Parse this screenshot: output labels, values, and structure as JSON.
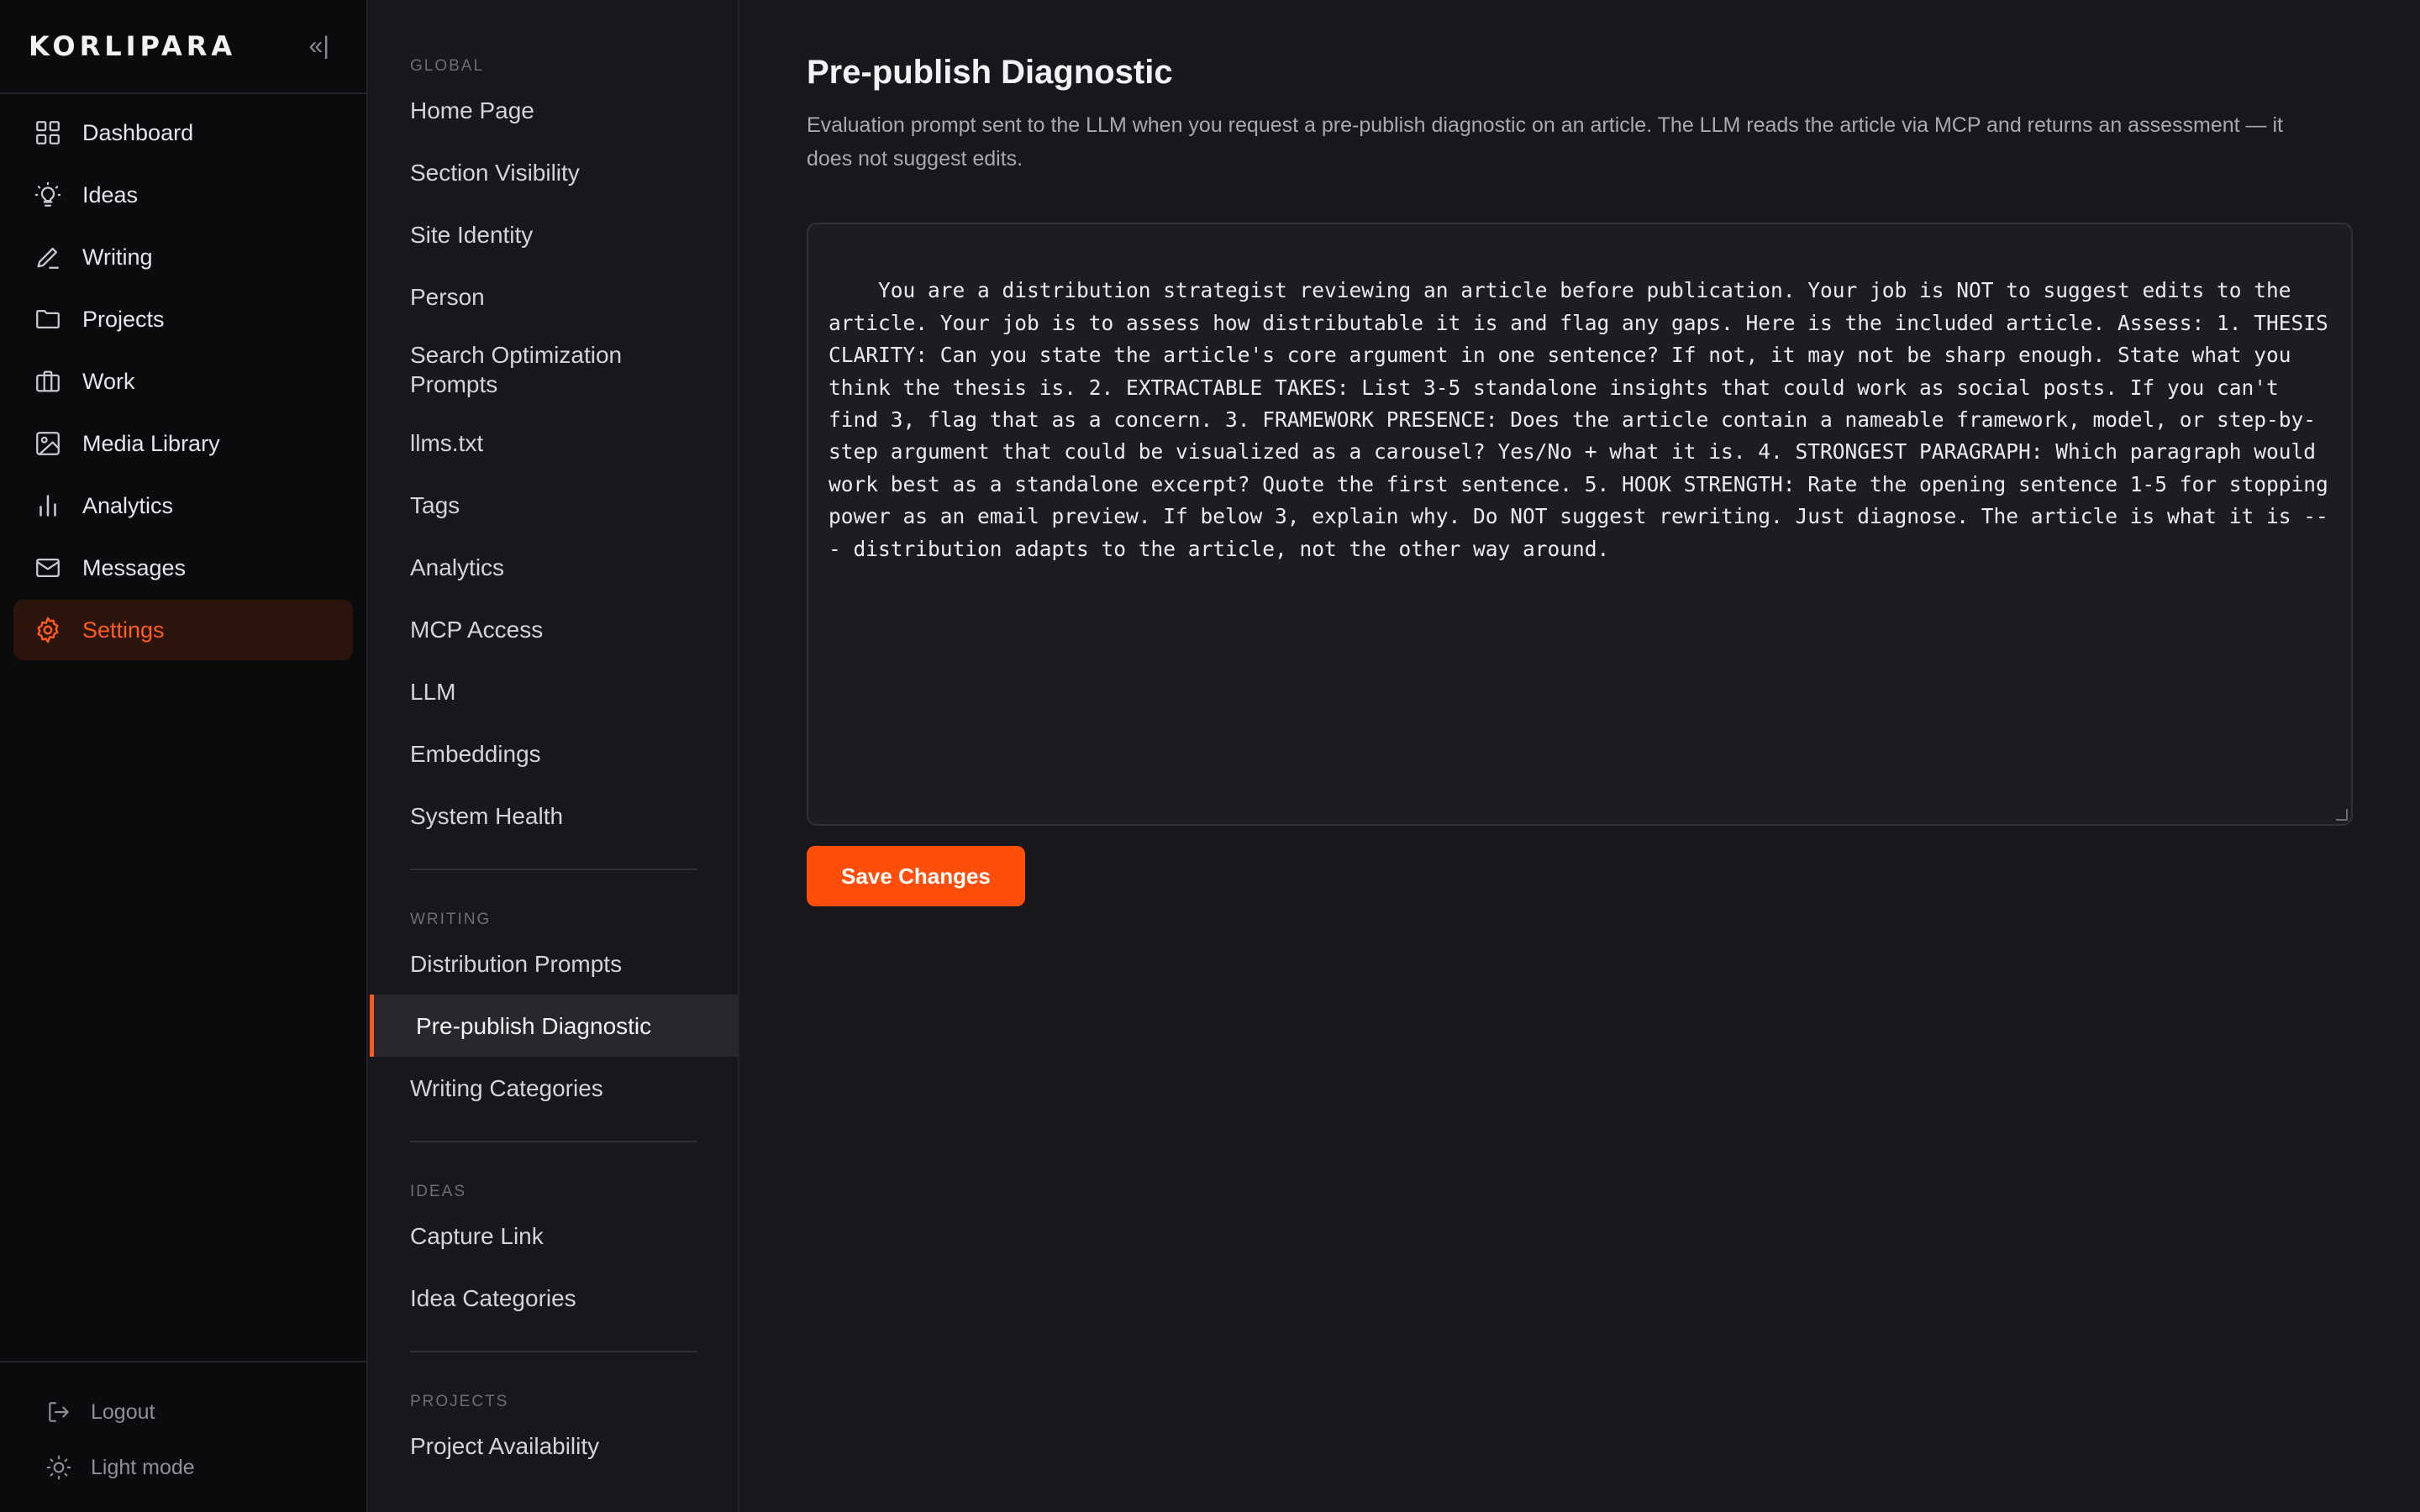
{
  "brand": {
    "name": "KORLIPARA",
    "collapse_icon": "«|"
  },
  "nav": [
    {
      "label": "Dashboard",
      "icon": "dashboard-icon"
    },
    {
      "label": "Ideas",
      "icon": "lightbulb-icon"
    },
    {
      "label": "Writing",
      "icon": "pen-icon"
    },
    {
      "label": "Projects",
      "icon": "folder-icon"
    },
    {
      "label": "Work",
      "icon": "briefcase-icon"
    },
    {
      "label": "Media Library",
      "icon": "image-icon"
    },
    {
      "label": "Analytics",
      "icon": "bar-chart-icon"
    },
    {
      "label": "Messages",
      "icon": "mail-icon"
    },
    {
      "label": "Settings",
      "icon": "gear-icon",
      "active": true
    }
  ],
  "bottom": {
    "logout": "Logout",
    "light_mode": "Light mode"
  },
  "subnav": {
    "global_label": "GLOBAL",
    "global": [
      "Home Page",
      "Section Visibility",
      "Site Identity",
      "Person",
      "Search Optimization Prompts",
      "llms.txt",
      "Tags",
      "Analytics",
      "MCP Access",
      "LLM",
      "Embeddings",
      "System Health"
    ],
    "writing_label": "WRITING",
    "writing": [
      "Distribution Prompts",
      "Pre-publish Diagnostic",
      "Writing Categories"
    ],
    "ideas_label": "IDEAS",
    "ideas": [
      "Capture Link",
      "Idea Categories"
    ],
    "projects_label": "PROJECTS",
    "projects": [
      "Project Availability"
    ]
  },
  "main": {
    "title": "Pre-publish Diagnostic",
    "description": "Evaluation prompt sent to the LLM when you request a pre-publish diagnostic on an article. The LLM reads the article via MCP and returns an assessment — it does not suggest edits.",
    "prompt": "You are a distribution strategist reviewing an article before publication. Your job is NOT to suggest edits to the article. Your job is to assess how distributable it is and flag any gaps. Here is the included article. Assess: 1. THESIS CLARITY: Can you state the article's core argument in one sentence? If not, it may not be sharp enough. State what you think the thesis is. 2. EXTRACTABLE TAKES: List 3-5 standalone insights that could work as social posts. If you can't find 3, flag that as a concern. 3. FRAMEWORK PRESENCE: Does the article contain a nameable framework, model, or step-by-step argument that could be visualized as a carousel? Yes/No + what it is. 4. STRONGEST PARAGRAPH: Which paragraph would work best as a standalone excerpt? Quote the first sentence. 5. HOOK STRENGTH: Rate the opening sentence 1-5 for stopping power as an email preview. If below 3, explain why. Do NOT suggest rewriting. Just diagnose. The article is what it is --- distribution adapts to the article, not the other way around.",
    "save_label": "Save Changes"
  },
  "colors": {
    "accent": "#ff5b1f",
    "button": "#ff4d0a",
    "sidebar_bg": "#0b0b0d",
    "content_bg": "#18181c"
  }
}
